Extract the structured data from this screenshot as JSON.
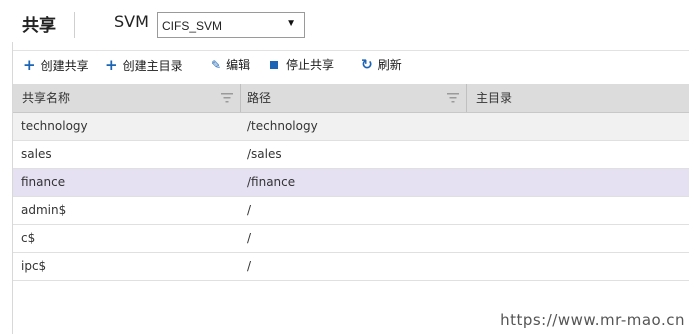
{
  "header": {
    "title": "共享",
    "svm_label": "SVM",
    "svm_selected": "CIFS_SVM"
  },
  "toolbar": {
    "create_share": "创建共享",
    "create_homedir": "创建主目录",
    "edit": "编辑",
    "stop_share": "停止共享",
    "refresh": "刷新"
  },
  "table": {
    "columns": [
      "共享名称",
      "路径",
      "主目录"
    ],
    "rows": [
      {
        "name": "technology",
        "path": "/technology",
        "home": ""
      },
      {
        "name": "sales",
        "path": "/sales",
        "home": ""
      },
      {
        "name": "finance",
        "path": "/finance",
        "home": ""
      },
      {
        "name": "admin$",
        "path": "/",
        "home": ""
      },
      {
        "name": "c$",
        "path": "/",
        "home": ""
      },
      {
        "name": "ipc$",
        "path": "/",
        "home": ""
      }
    ]
  },
  "watermark": "https://www.mr-mao.cn",
  "colors": {
    "accent": "#1c64b4",
    "header_bg": "#dcdcdc",
    "selected_row": "#e6e0f3",
    "alt_row": "#f1f1f1"
  }
}
